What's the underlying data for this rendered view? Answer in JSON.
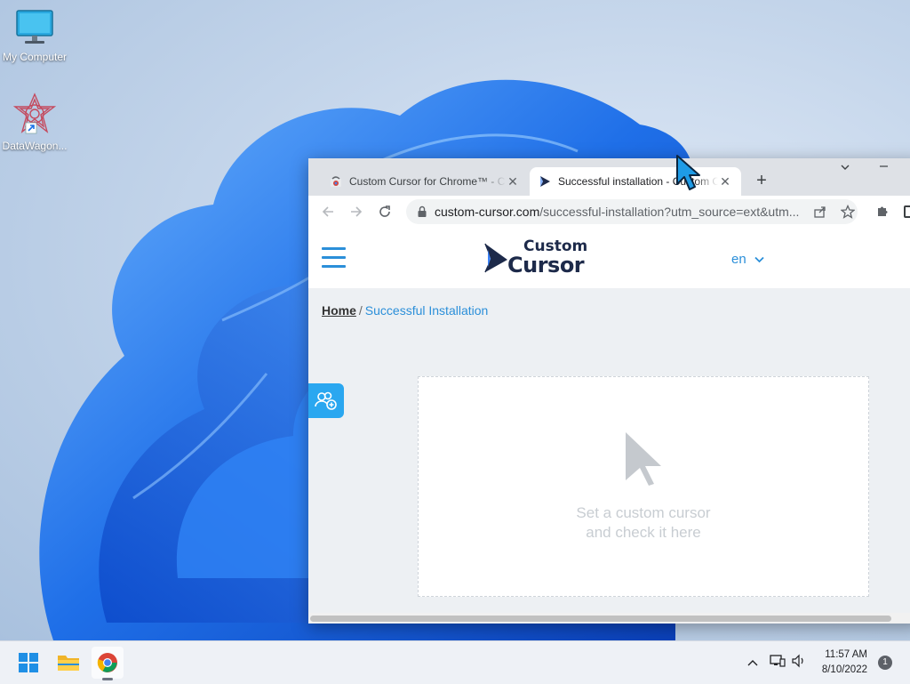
{
  "desktop": {
    "icons": [
      {
        "label": "My Computer"
      },
      {
        "label": "DataWagon..."
      }
    ]
  },
  "browser": {
    "tabs": [
      {
        "title": "Custom Cursor for Chrome™ - Chrome Web Store",
        "active": false
      },
      {
        "title": "Successful installation - Custom Cursor",
        "active": true
      }
    ],
    "address": {
      "domain": "custom-cursor.com",
      "path": "/successful-installation?utm_source=ext&utm..."
    },
    "page": {
      "logo_top": "Custom",
      "logo_bottom": "Cursor",
      "language": "en",
      "breadcrumb": {
        "home": "Home",
        "separator": "/",
        "current": "Successful Installation"
      },
      "test_area": {
        "line1": "Set a custom cursor",
        "line2": "and check it here"
      }
    }
  },
  "taskbar": {
    "time": "11:57 AM",
    "date": "8/10/2022",
    "notification_count": "1"
  },
  "colors": {
    "accent": "#2b8fd9",
    "side_button": "#2aa7f0",
    "wallpaper_blue": "#1f6fe8"
  }
}
